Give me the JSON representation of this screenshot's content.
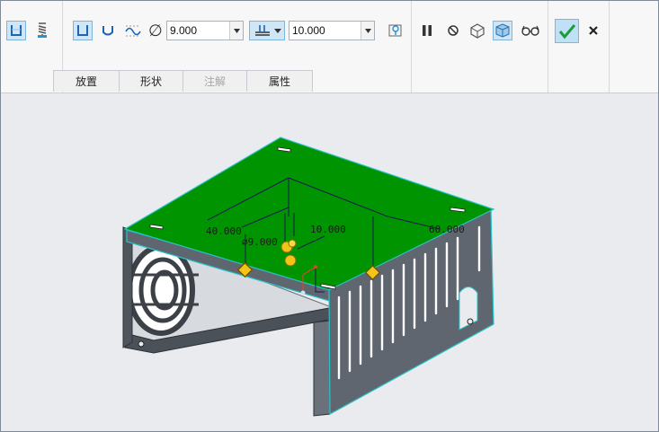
{
  "dashboard": {
    "diameter_value": "9.000",
    "depth_value": "10.000",
    "diameter_symbol": "∅",
    "tabs": [
      {
        "label": "放置",
        "enabled": true
      },
      {
        "label": "形状",
        "enabled": true
      },
      {
        "label": "注解",
        "enabled": false
      },
      {
        "label": "属性",
        "enabled": true
      }
    ]
  },
  "viewport": {
    "dimensions": {
      "left_offset": "40.000",
      "diameter": "∅9.000",
      "depth": "10.000",
      "right_offset": "60.000"
    }
  },
  "colors": {
    "accent": "#2b8fd6",
    "top_face": "#009400",
    "body_gray": "#5f6670",
    "edge_highlight": "#27c3c8",
    "handle": "#f2c318",
    "confirm": "#1f9c3a"
  },
  "icons": [
    "hole-straight-icon",
    "hole-standard-icon",
    "simple-hole-icon",
    "standard-profile-icon",
    "sketch-profile-icon",
    "diameter-icon",
    "depth-blind-icon",
    "hole-info-icon",
    "pause-icon",
    "no-preview-icon",
    "preview-geometry-icon",
    "verify-icon",
    "glasses-icon",
    "confirm-check-icon",
    "cancel-x-icon"
  ]
}
